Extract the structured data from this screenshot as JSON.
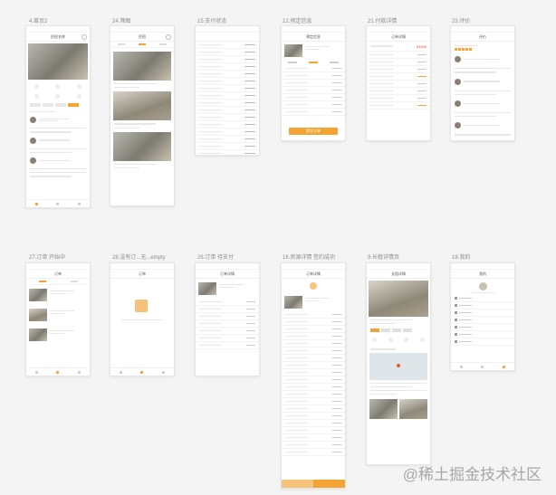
{
  "screens": [
    {
      "label": "4.首页2",
      "title": "民宿名称"
    },
    {
      "label": "24.筛图",
      "title": "民宿"
    },
    {
      "label": "15.支付状态",
      "title": ""
    },
    {
      "label": "12.预定信息",
      "title": "预定信息",
      "action": "提交订单"
    },
    {
      "label": "21.付款详情",
      "title": "订单详情",
      "amount": "¥3998"
    },
    {
      "label": "23.评价",
      "title": "评价"
    },
    {
      "label": "27.订单 开始中",
      "title": "订单"
    },
    {
      "label": "28.没有订...无...empty",
      "title": "订单"
    },
    {
      "label": "26.订单 待支付",
      "title": "订单详情"
    },
    {
      "label": "16.房源详情 签约成功",
      "title": "订单详情"
    },
    {
      "label": "9.长租详情页",
      "title": "长租详情"
    },
    {
      "label": "18.我的",
      "title": "我的"
    }
  ],
  "watermark": "@稀土掘金技术社区",
  "accent_color": "#f5a332"
}
